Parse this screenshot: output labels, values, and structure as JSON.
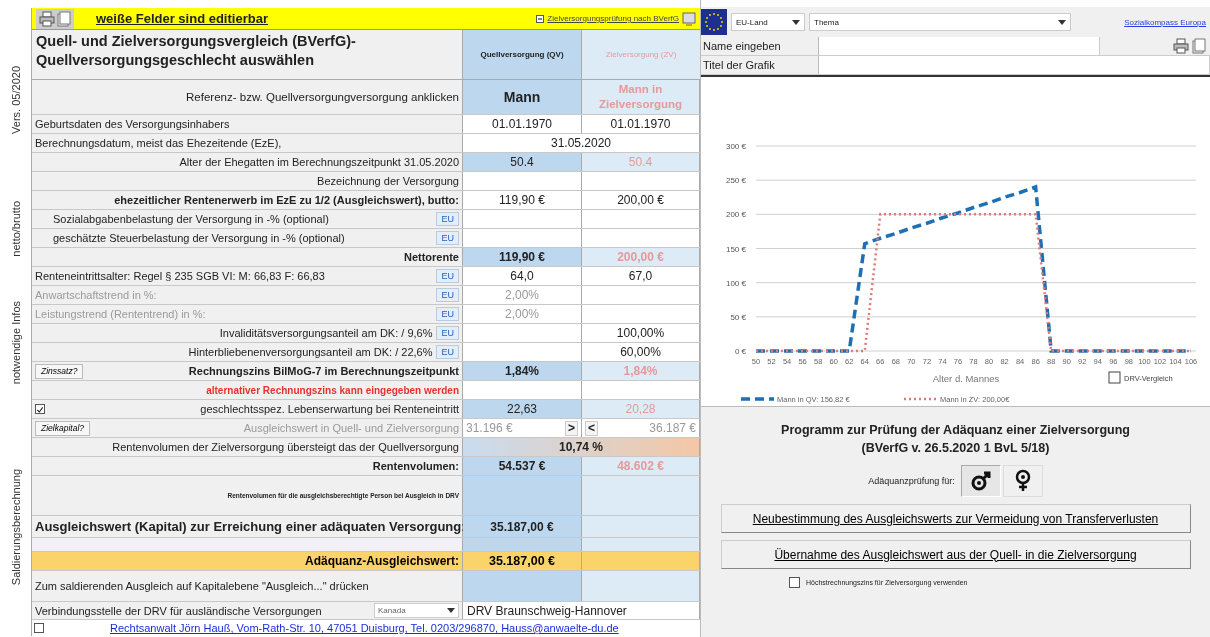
{
  "toolbar": {
    "banner": "weiße Felder sind editierbar",
    "check": {
      "label": "Zielversorgungsprüfung nach BVerfG",
      "checked": true
    }
  },
  "title": {
    "lines": [
      "Quell- und Zielversorgungsvergleich (BVerfG)-",
      "Quellversorgungsgeschlecht auswählen"
    ],
    "qv_header": "Quellversorgung (QV)",
    "zv_header": "Zielversorgung (ZV)"
  },
  "sections": [
    {
      "label": "Vers. 05/2020",
      "rows": [
        {
          "kind": "header",
          "label": "Referenz- bzw. Quellversorgungversorgung anklicken",
          "qv": "Mann",
          "zv": "Mann in Zielversorgung",
          "highlight": true
        },
        {
          "kind": "note",
          "label": "Geburtsdaten des Versorgungsinhabers",
          "qv": "01.01.1970",
          "zv": "01.01.1970",
          "highlight": false
        },
        {
          "kind": "note",
          "label": "Berechnungsdatum, meist das Ehezeitende (EzE),",
          "span": "31.05.2020",
          "alert": false
        },
        {
          "kind": "field",
          "label": "Alter der Ehegatten im Berechnungszeitpunkt 31.05.2020",
          "qv": "50.4",
          "zv": "50.4",
          "highlight": true
        },
        {
          "kind": "field",
          "label": "Bezeichnung der Versorgung",
          "highlight": false
        }
      ]
    },
    {
      "label": "netto/brutto",
      "rows": [
        {
          "kind": "strong",
          "label": "ehezeitlicher Rentenerwerb im EzE zu 1/2 (Ausgleichswert), butto:",
          "qv": "119,90 €",
          "zv": "200,00 €",
          "highlight": false
        },
        {
          "kind": "indent",
          "label": "Sozialabgabenbelastung der Versorgung in -% (optional)",
          "eu": "EU",
          "highlight": false
        },
        {
          "kind": "indent",
          "label": "geschätzte Steuerbelastung der Versorgung in -% (optional)",
          "eu": "EU",
          "highlight": false
        },
        {
          "kind": "strong",
          "label": "Nettorente",
          "qv": "119,90 €",
          "zv": "200,00 €",
          "highlight": true
        }
      ]
    },
    {
      "label": "notwendige Infos",
      "rows": [
        {
          "kind": "note",
          "label": "Renteneintrittsalter: Regel § 235 SGB VI: M: 66,83   F: 66,83",
          "eu": "EU",
          "qv": "64,0",
          "zv": "67,0",
          "highlight": false
        },
        {
          "kind": "note",
          "label": "Anwartschaftstrend in %:",
          "eu": "EU",
          "qv": "2,00%",
          "highlight": false,
          "dim": true
        },
        {
          "kind": "note",
          "label": "Leistungstrend (Rententrend) in %:",
          "eu": "EU",
          "qv": "2,00%",
          "highlight": false,
          "dim": true
        },
        {
          "kind": "field",
          "label": "Invaliditätsversorgungsanteil am DK:  / 9,6%",
          "eu": "EU",
          "zv": "100,00%",
          "highlight": false
        },
        {
          "kind": "field",
          "label": "Hinterbliebenenversorgungsanteil am DK:  / 22,6%",
          "eu": "EU",
          "zv": "60,00%",
          "highlight": false
        },
        {
          "kind": "strong",
          "label": "Rechnungszins BilMoG-7 im Berechnungszeitpunkt",
          "action": "Zinssatz?",
          "qv": "1,84%",
          "zv": "1,84%",
          "highlight": true
        },
        {
          "kind": "warning",
          "label": "alternativer Rechnungszins kann eingegeben werden",
          "highlight": false
        },
        {
          "kind": "field",
          "label": "geschlechtsspez. Lebenserwartung bei Renteneintritt",
          "checkbox": {
            "checked": true
          },
          "qv": "22,63",
          "zv": "20,28",
          "highlight": true
        }
      ]
    },
    {
      "label": "Saldierungsberechnung",
      "rows": [
        {
          "kind": "field",
          "label": "Ausgleichswert in Quell- und Zielversorgung",
          "action": "Zielkapital?",
          "qv": "31.196 €",
          "qv_sign": ">",
          "zv_sign": "<",
          "zv": "36.187 €",
          "highlight": false,
          "dim": true
        },
        {
          "kind": "field",
          "label": "Rentenvolumen der Zielversorgung übersteigt das der Quellversorgung",
          "span": "10,74 %",
          "alert": true
        },
        {
          "kind": "strong",
          "label": "Rentenvolumen:",
          "qv": "54.537 €",
          "zv": "48.602 €",
          "highlight": true
        },
        {
          "kind": "tiny",
          "label": "Rentenvolumen für die ausgleichsberechtigte Person bei Ausgleich in DRV",
          "highlight": true
        },
        {
          "kind": "big",
          "label": "Ausgleichswert (Kapital) zur Erreichung einer adäquaten Versorgung:",
          "qv": "35.187,00 €",
          "highlight": true
        },
        {
          "kind": "blank",
          "highlight": true
        },
        {
          "kind": "gold",
          "label": "Adäquanz-Ausgleichswert:",
          "qv": "35.187,00 €",
          "highlight": true
        },
        {
          "kind": "prompt",
          "label": "Zum saldierenden Ausgleich auf Kapitalebene \"Ausgleich...\" drücken",
          "highlight": true
        },
        {
          "kind": "drv",
          "label": "Verbindungsstelle der DRV für ausländische Versorgungen",
          "dropdown": "Kanada",
          "span": "DRV Braunschweig-Hannover",
          "alert": false
        }
      ]
    }
  ],
  "footer": {
    "checkbox": {
      "checked": false
    },
    "link": "Rechtsanwalt Jörn Hauß, Vom-Rath-Str. 10, 47051 Duisburg, Tel. 0203/296870, Hauss@anwaelte-du.de"
  },
  "right": {
    "region_dropdown": "EU-Land",
    "topic_dropdown": "Thema",
    "link": "Sozialkompass Europa",
    "name_label": "Name eingeben",
    "title_label": "Titel der Grafik",
    "chart": {
      "chart_data": {
        "type": "line",
        "xlabel": "Alter d. Mannes",
        "categories": [
          "50",
          "52",
          "54",
          "56",
          "58",
          "60",
          "62",
          "64",
          "66",
          "68",
          "70",
          "72",
          "74",
          "76",
          "78",
          "80",
          "82",
          "84",
          "86",
          "88",
          "90",
          "92",
          "94",
          "96",
          "98",
          "100",
          "102",
          "104",
          "106"
        ],
        "series": [
          {
            "name": "Mann in QV: 156,82 €",
            "color": "#1f6fb5",
            "line_style": "dashed",
            "values": [
              0,
              0,
              0,
              0,
              0,
              0,
              0,
              157,
              165,
              172,
              180,
              187,
              195,
              202,
              210,
              217,
              225,
              232,
              240,
              0,
              0,
              0,
              0,
              0,
              0,
              0,
              0,
              0,
              0
            ]
          },
          {
            "name": "Mann in ZV: 200,00€",
            "color": "#e07a7a",
            "line_style": "dotted",
            "values": [
              0,
              0,
              0,
              0,
              0,
              0,
              0,
              0,
              200,
              200,
              200,
              200,
              200,
              200,
              200,
              200,
              200,
              200,
              200,
              0,
              0,
              0,
              0,
              0,
              0,
              0,
              0,
              0,
              0
            ]
          }
        ],
        "ylim": [
          0,
          300
        ],
        "grid": true,
        "legend": true,
        "yticks": [
          {
            "value": 0,
            "label": "0 €"
          },
          {
            "value": 50,
            "label": "50 €"
          },
          {
            "value": 100,
            "label": "100 €"
          },
          {
            "value": 150,
            "label": "150 €"
          },
          {
            "value": 200,
            "label": "200 €"
          },
          {
            "value": 250,
            "label": "250 €"
          },
          {
            "value": 300,
            "label": "300 €"
          }
        ]
      },
      "drv_checkbox": {
        "label": "DRV-Vergleich",
        "checked": false
      }
    },
    "panel": {
      "title_lines": [
        "Programm zur Prüfung der Adäquanz einer Zielversorgung",
        "(BVerfG v. 26.5.2020 1 BvL 5/18)"
      ],
      "gender_label": "Adäquanzprüfung für:",
      "genders": [
        {
          "kind": "male",
          "selected": true
        },
        {
          "kind": "female",
          "selected": false
        }
      ],
      "buttons": [
        "Neubestimmung des Ausgleichswerts zur Vermeidung von Transferverlusten",
        "Übernahme des Ausgleichswert aus der Quell- in die Zielversorgung"
      ],
      "option": {
        "label": "Höchstrechnungszins für Zielversorgung verwenden",
        "checked": false
      }
    }
  }
}
